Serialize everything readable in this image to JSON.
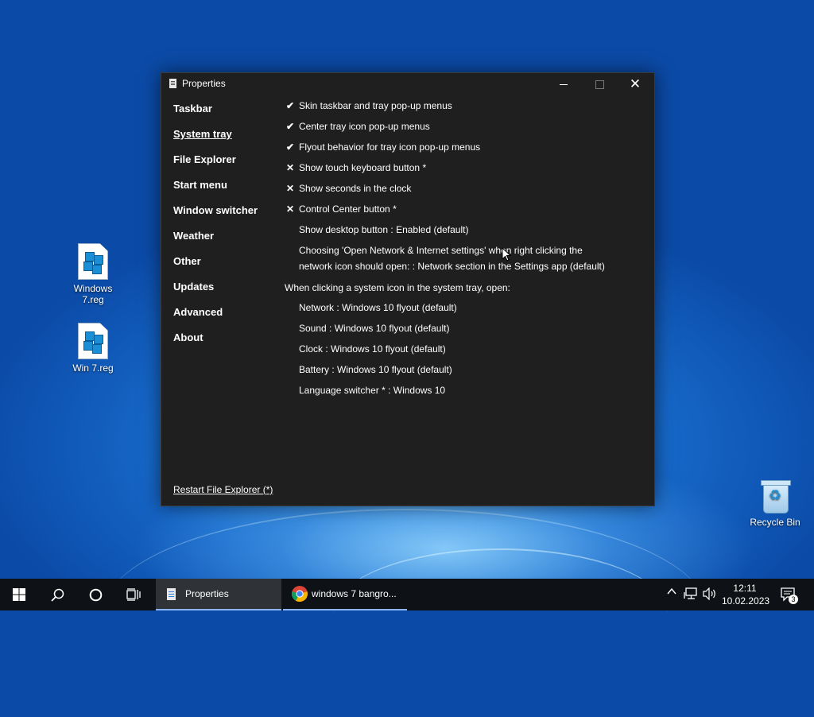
{
  "desktop": {
    "icons": [
      {
        "label": "Windows 7.reg"
      },
      {
        "label": "Win 7.reg"
      },
      {
        "label": "Recycle Bin"
      }
    ]
  },
  "window": {
    "title": "Properties",
    "nav": [
      {
        "label": "Taskbar"
      },
      {
        "label": "System tray"
      },
      {
        "label": "File Explorer"
      },
      {
        "label": "Start menu"
      },
      {
        "label": "Window switcher"
      },
      {
        "label": "Weather"
      },
      {
        "label": "Other"
      },
      {
        "label": "Updates"
      },
      {
        "label": "Advanced"
      },
      {
        "label": "About"
      }
    ],
    "active_nav": "System tray",
    "options": [
      {
        "mark": "✔",
        "label": "Skin taskbar and tray pop-up menus"
      },
      {
        "mark": "✔",
        "label": "Center tray icon pop-up menus"
      },
      {
        "mark": "✔",
        "label": "Flyout behavior for tray icon pop-up menus"
      },
      {
        "mark": "✕",
        "label": "Show touch keyboard button *"
      },
      {
        "mark": "✕",
        "label": "Show seconds in the clock"
      },
      {
        "mark": "✕",
        "label": "Control Center button *"
      },
      {
        "mark": "",
        "label": "Show desktop button : Enabled (default)"
      },
      {
        "mark": "",
        "label": "Choosing 'Open Network & Internet settings' when right clicking the"
      },
      {
        "mark": "",
        "label": "network icon should open: : Network section in the Settings app (default)"
      }
    ],
    "section_heading": "When clicking a system icon in the system tray, open:",
    "flyouts": [
      {
        "label": "Network : Windows 10 flyout (default)"
      },
      {
        "label": "Sound : Windows 10 flyout (default)"
      },
      {
        "label": "Clock : Windows 10 flyout (default)"
      },
      {
        "label": "Battery : Windows 10 flyout (default)"
      },
      {
        "label": "Language switcher * : Windows 10"
      }
    ],
    "restart_link": "Restart File Explorer (*)"
  },
  "taskbar": {
    "apps": [
      {
        "label": "Properties"
      },
      {
        "label": "windows 7 bangro..."
      }
    ],
    "time": "12:11",
    "date": "10.02.2023",
    "notification_count": "3"
  }
}
